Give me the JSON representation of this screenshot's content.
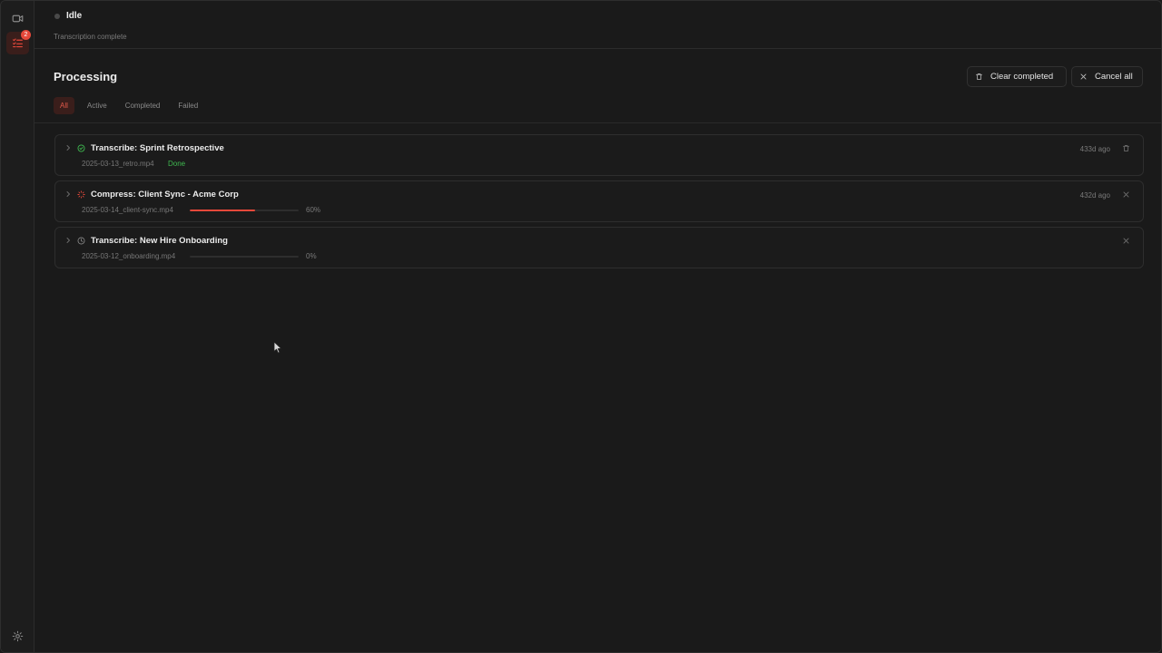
{
  "status": {
    "title": "Idle",
    "subtitle": "Transcription complete"
  },
  "sidebar": {
    "queue_badge": "2"
  },
  "header": {
    "title": "Processing",
    "clear_completed_label": "Clear completed",
    "cancel_all_label": "Cancel all"
  },
  "tabs": [
    {
      "label": "All",
      "active": true
    },
    {
      "label": "Active",
      "active": false
    },
    {
      "label": "Completed",
      "active": false
    },
    {
      "label": "Failed",
      "active": false
    }
  ],
  "jobs": [
    {
      "title": "Transcribe: Sprint Retrospective",
      "file": "2025-03-13_retro.mp4",
      "status": "completed",
      "status_label": "Done",
      "time": "433d ago"
    },
    {
      "title": "Compress: Client Sync - Acme Corp",
      "file": "2025-03-14_client-sync.mp4",
      "status": "running",
      "progress": 0.6,
      "progress_label": "60%",
      "time": "432d ago"
    },
    {
      "title": "Transcribe: New Hire Onboarding",
      "file": "2025-03-12_onboarding.mp4",
      "status": "queued",
      "progress": 0.0,
      "progress_label": "0%",
      "time": ""
    }
  ],
  "colors": {
    "accent": "#e5483a",
    "success": "#3fb950",
    "background": "#1a1a1a"
  }
}
